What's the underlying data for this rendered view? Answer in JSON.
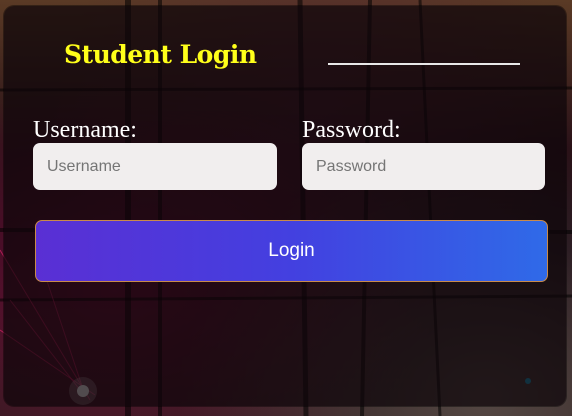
{
  "login": {
    "title": "Student Login",
    "username_label": "Username:",
    "username_placeholder": "Username",
    "password_label": "Password:",
    "password_placeholder": "Password",
    "submit_label": "Login"
  },
  "colors": {
    "title": "#ffff1a",
    "button_gradient_start": "#5a2fd4",
    "button_gradient_end": "#2f6ae8",
    "panel_background": "rgba(14,6,10,0.72)"
  }
}
